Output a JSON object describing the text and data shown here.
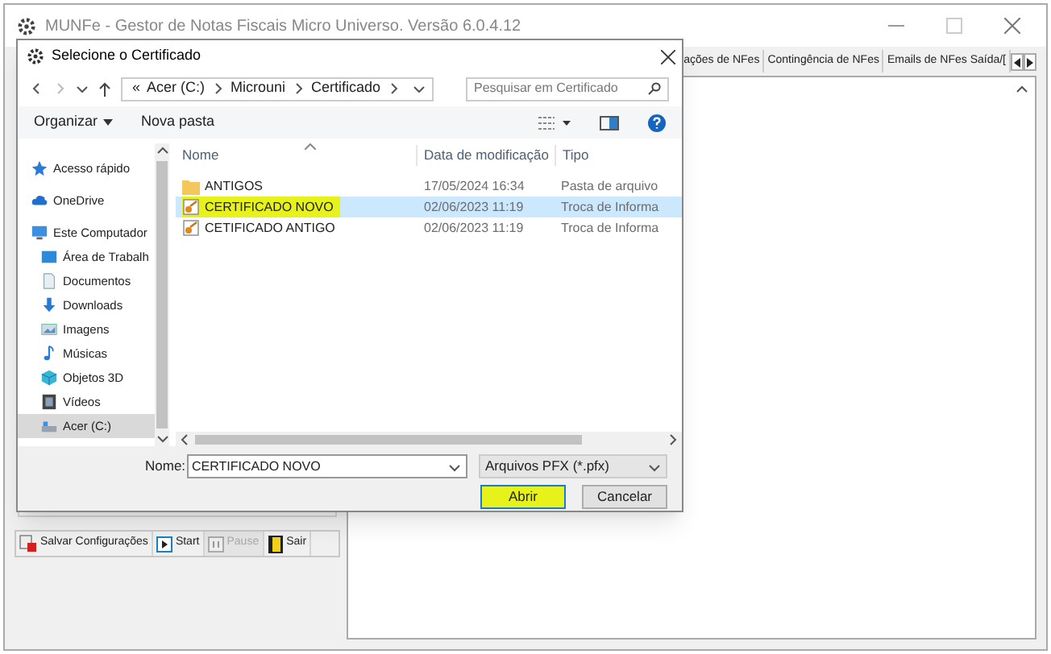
{
  "window": {
    "title": "MUNFe - Gestor de Notas Fiscais Micro Universo. Versão 6.0.4.12"
  },
  "tabs": [
    {
      "label": "ações de NFes",
      "selected": false
    },
    {
      "label": "Contingência de NFes",
      "selected": false
    },
    {
      "label": "Emails de NFes Saída/[",
      "selected": false
    }
  ],
  "toolbar": [
    {
      "label": "Salvar Configurações",
      "kind": "save",
      "disabled": false
    },
    {
      "label": "Start",
      "kind": "start",
      "disabled": false
    },
    {
      "label": "Pause",
      "kind": "pause",
      "disabled": true
    },
    {
      "label": "Sair",
      "kind": "exit",
      "disabled": false
    }
  ],
  "dialog": {
    "title": "Selecione o Certificado",
    "path": [
      {
        "label": "«"
      },
      {
        "label": "Acer (C:)"
      },
      {
        "label": "Microuni"
      },
      {
        "label": "Certificado"
      }
    ],
    "search": {
      "placeholder": "Pesquisar em Certificado"
    },
    "commands": [
      {
        "label": "Organizar",
        "kind": "menu"
      },
      {
        "label": "Nova pasta",
        "kind": "plain"
      }
    ],
    "nav": [
      {
        "label": "Acesso rápido",
        "kind": "star",
        "selected": false
      },
      {
        "label": "OneDrive",
        "kind": "cloud",
        "selected": false
      },
      {
        "label": "Este Computador",
        "kind": "pc",
        "selected": false,
        "children": [
          {
            "label": "Área de Trabalh",
            "kind": "desktop",
            "selected": false
          },
          {
            "label": "Documentos",
            "kind": "docs",
            "selected": false
          },
          {
            "label": "Downloads",
            "kind": "download",
            "selected": false
          },
          {
            "label": "Imagens",
            "kind": "images",
            "selected": false
          },
          {
            "label": "Músicas",
            "kind": "music",
            "selected": false
          },
          {
            "label": "Objetos 3D",
            "kind": "cube",
            "selected": false
          },
          {
            "label": "Vídeos",
            "kind": "video",
            "selected": false
          },
          {
            "label": "Acer (C:)",
            "kind": "drive",
            "selected": true
          }
        ]
      }
    ],
    "columns": [
      "Nome",
      "Data de modificação",
      "Tipo"
    ],
    "files": [
      {
        "name": "ANTIGOS",
        "date": "17/05/2024 16:34",
        "type": "Pasta de arquivo",
        "kind": "folder",
        "selected": false,
        "highlighted": false
      },
      {
        "name": "CERTIFICADO NOVO",
        "date": "02/06/2023 11:19",
        "type": "Troca de Informa",
        "kind": "cert",
        "selected": true,
        "highlighted": true
      },
      {
        "name": "CETIFICADO ANTIGO",
        "date": "02/06/2023 11:19",
        "type": "Troca de Informa",
        "kind": "cert",
        "selected": false,
        "highlighted": false
      }
    ],
    "filename": {
      "label": "Nome:",
      "value": "CERTIFICADO NOVO"
    },
    "filetype": {
      "value": "Arquivos PFX (*.pfx)"
    },
    "buttons": [
      {
        "label": "Abrir",
        "highlighted": true
      },
      {
        "label": "Cancelar",
        "highlighted": false
      }
    ]
  }
}
